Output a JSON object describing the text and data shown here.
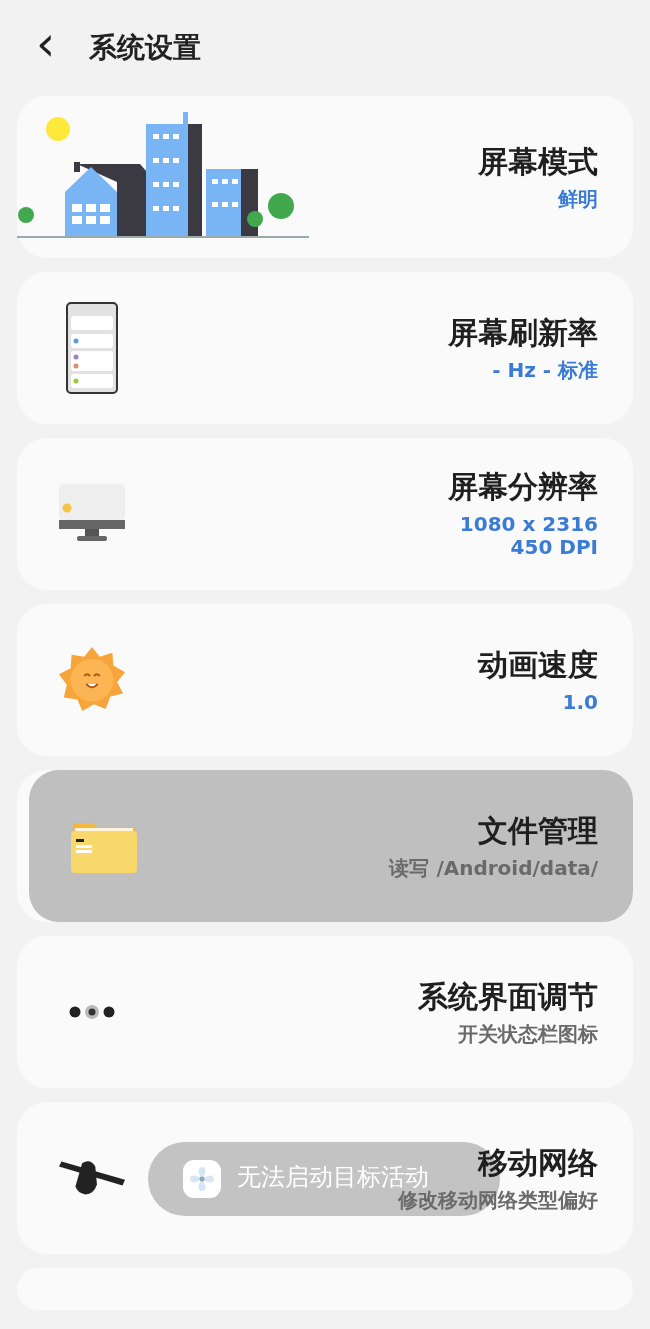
{
  "header": {
    "back_icon": "‹",
    "title": "系统设置"
  },
  "items": [
    {
      "title": "屏幕模式",
      "subtitle": "鲜明",
      "kind": "value",
      "pressed": false
    },
    {
      "title": "屏幕刷新率",
      "subtitle": "- Hz - 标准",
      "kind": "value",
      "pressed": false
    },
    {
      "title": "屏幕分辨率",
      "subtitle": "1080 x 2316\n450 DPI",
      "kind": "value",
      "pressed": false
    },
    {
      "title": "动画速度",
      "subtitle": "1.0",
      "kind": "value",
      "pressed": false
    },
    {
      "title": "文件管理",
      "subtitle": "读写 /Android/data/",
      "kind": "description",
      "pressed": true
    },
    {
      "title": "系统界面调节",
      "subtitle": "开关状态栏图标",
      "kind": "description",
      "pressed": false
    },
    {
      "title": "移动网络",
      "subtitle": "修改移动网络类型偏好",
      "kind": "description",
      "pressed": false
    }
  ],
  "toast": {
    "text": "无法启动目标活动"
  }
}
